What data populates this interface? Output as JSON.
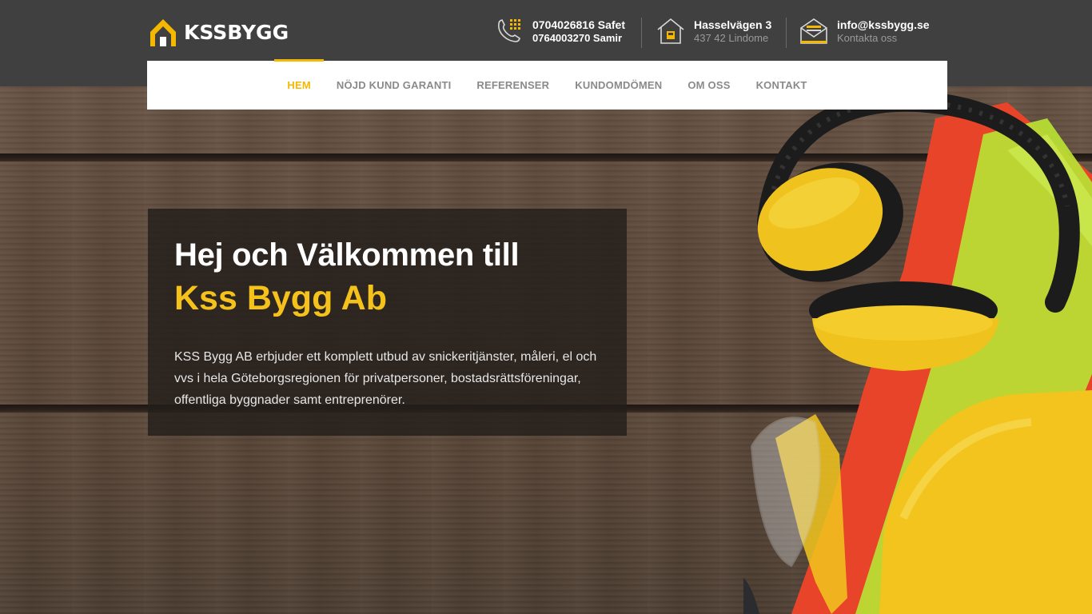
{
  "brand": {
    "name": "KSSBYGG"
  },
  "header": {
    "phone": {
      "line1": "0704026816 Safet",
      "line2": "0764003270 Samir",
      "icon": "phone-icon"
    },
    "address": {
      "line1": "Hasselvägen 3",
      "line2": "437 42 Lindome",
      "icon": "house-icon"
    },
    "email": {
      "line1": "info@kssbygg.se",
      "line2": "Kontakta oss",
      "icon": "envelope-icon"
    }
  },
  "nav": {
    "items": [
      {
        "label": "HEM",
        "active": true
      },
      {
        "label": "NÖJD KUND GARANTI",
        "active": false
      },
      {
        "label": "REFERENSER",
        "active": false
      },
      {
        "label": "KUNDOMDÖMEN",
        "active": false
      },
      {
        "label": "OM OSS",
        "active": false
      },
      {
        "label": "KONTAKT",
        "active": false
      }
    ]
  },
  "hero": {
    "title_line1": "Hej och Välkommen till",
    "title_line2": "Kss Bygg Ab",
    "description": "KSS Bygg AB erbjuder ett komplett utbud av snickeritjänster, måleri, el och vvs i hela Göteborgsregionen för privatpersoner, bostadsrättsföreningar, offentliga byggnader samt entreprenörer."
  },
  "colors": {
    "accent": "#f5b800",
    "topbar": "#404040",
    "nav_bg": "#ffffff"
  }
}
